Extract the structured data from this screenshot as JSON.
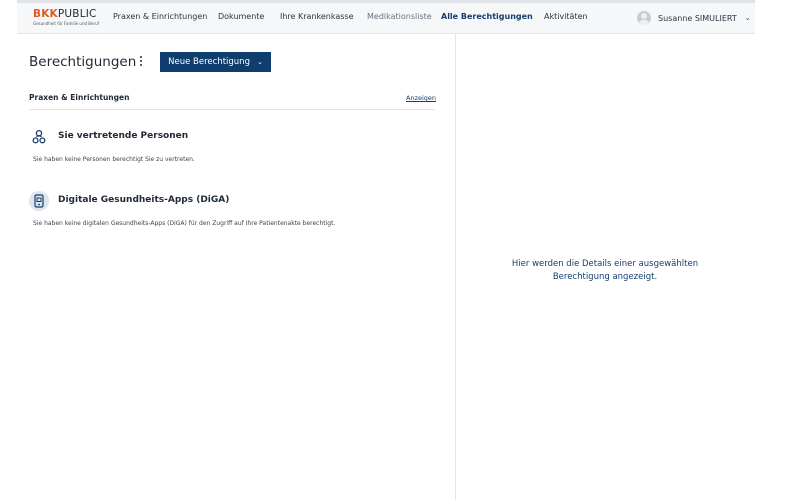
{
  "header": {
    "logo_brand_accent": "BKK",
    "logo_brand_rest": "PUBLIC",
    "logo_tagline": "Gesundheit für Familie und Beruf",
    "nav": [
      {
        "label": "Praxen & Einrichtungen",
        "state": "normal"
      },
      {
        "label": "Dokumente",
        "state": "normal"
      },
      {
        "label": "Ihre Krankenkasse",
        "state": "normal"
      },
      {
        "label": "Medikationsliste",
        "state": "muted"
      },
      {
        "label": "Alle Berechtigungen",
        "state": "active"
      },
      {
        "label": "Aktivitäten",
        "state": "normal"
      }
    ],
    "user_name": "Susanne SIMULIERT"
  },
  "main": {
    "title": "Berechtigungen",
    "new_button_label": "Neue Berechtigung",
    "section": {
      "title": "Praxen & Einrichtungen",
      "link_label": "Anzeigen"
    },
    "groups": [
      {
        "icon": "people-icon",
        "title": "Sie vertretende Personen",
        "text": "Sie haben keine Personen berechtigt Sie zu vertreten."
      },
      {
        "icon": "app-device-icon",
        "title": "Digitale Gesundheits-Apps (DiGA)",
        "text": "Sie haben keine digitalen Gesundheits-Apps (DiGA) für den Zugriff auf Ihre Patientenakte berechtigt."
      }
    ]
  },
  "detail": {
    "placeholder_line1": "Hier werden die Details einer ausgewählten",
    "placeholder_line2": "Berechtigung angezeigt."
  },
  "colors": {
    "brand_accent": "#e0591e",
    "primary": "#0f3d6e",
    "link": "#153e6e"
  }
}
